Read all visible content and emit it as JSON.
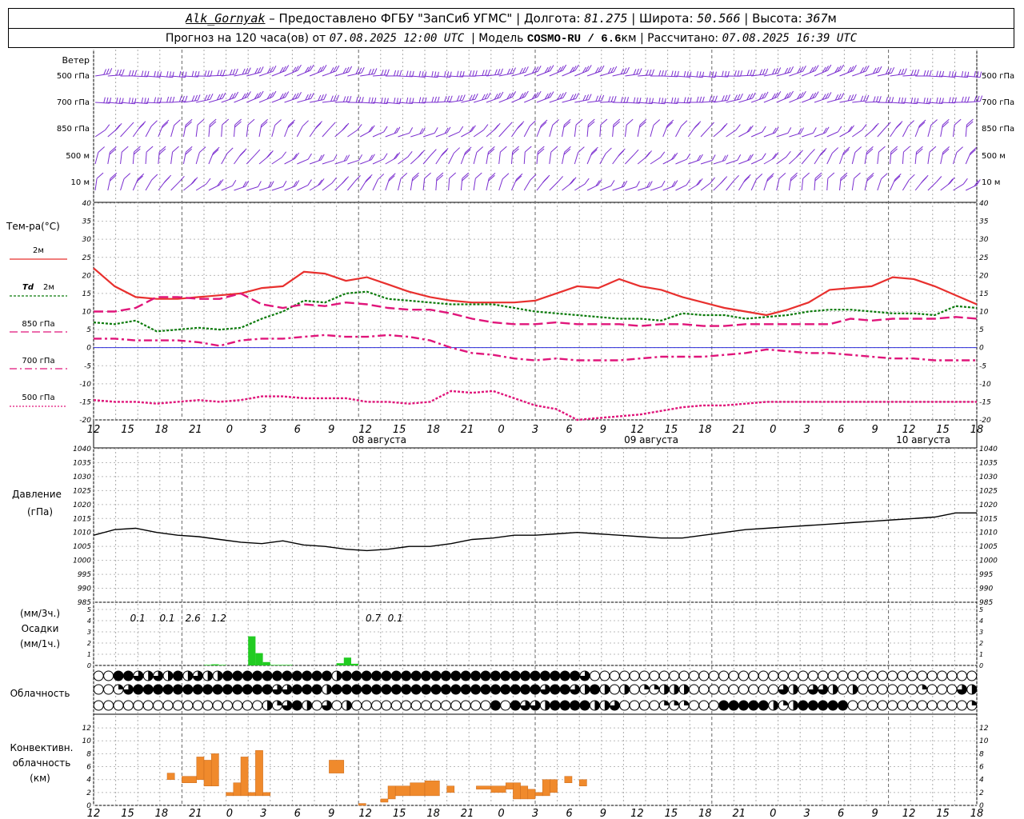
{
  "header": {
    "station": "Alk_Gornyak",
    "provided_by": "– Предоставлено ФГБУ \"ЗапСиб УГМС\"",
    "lon_label": "Долгота:",
    "lon_value": "81.275",
    "lat_label": "Широта:",
    "lat_value": "50.566",
    "alt_label": "Высота:",
    "alt_value": "367",
    "alt_unit": "м",
    "forecast_label": "Прогноз на 120 часа(ов) от",
    "forecast_start": "07.08.2025 12:00 UTC",
    "model_label": "Модель",
    "model_name": "COSMO-RU / 6.6",
    "model_unit": "км",
    "computed_label": "Рассчитано:",
    "computed_value": "07.08.2025 16:39 UTC"
  },
  "labels": {
    "wind_title": "Ветер",
    "temp_title": "Тем-ра(°C)",
    "t2m": "2м",
    "td": "Td",
    "td_2m": "2м",
    "t850": "850 гПа",
    "t700": "700 гПа",
    "t500": "500 гПа",
    "pressure_title": "Давление",
    "pressure_unit": "(гПа)",
    "precip_unit3": "(мм/3ч.)",
    "precip_title": "Осадки",
    "precip_unit1": "(мм/1ч.)",
    "cloud_title": "Облачность",
    "conv_title1": "Конвективн.",
    "conv_title2": "облачность",
    "conv_unit": "(км)"
  },
  "colors": {
    "wind": "#7b2fd0",
    "t2m": "#e8302e",
    "td": "#0a7a0a",
    "t850": "#e0157a",
    "t700": "#e0157a",
    "t500": "#e0157a",
    "pressure": "#000000",
    "precip": "#22cc22",
    "conv": "#f08a2c",
    "zero_line": "#2b2bd8"
  },
  "chart_data": [
    {
      "type": "barbs",
      "name": "wind",
      "levels": [
        "500 гПа",
        "700 гПа",
        "850 гПа",
        "500 м",
        "10 м"
      ],
      "x_hours": [
        0,
        120
      ],
      "barbs_per_level": 70,
      "direction_pattern": "west/north-west barbs, 500 and 700 hPa barbs crowded (strong winds), lower levels weaker"
    },
    {
      "type": "line",
      "name": "temperature",
      "x_tick_labels": [
        "12",
        "15",
        "18",
        "21",
        "0",
        "3",
        "6",
        "9",
        "12",
        "15",
        "18",
        "21",
        "0",
        "3",
        "6",
        "9",
        "12",
        "15",
        "18",
        "21",
        "0",
        "3",
        "6",
        "9",
        "12",
        "15",
        "18"
      ],
      "date_labels": [
        "08 августа",
        "09 августа",
        "10 августа"
      ],
      "ylim": [
        -20,
        40
      ],
      "y_ticks": [
        40,
        35,
        30,
        25,
        20,
        15,
        10,
        5,
        0,
        -5,
        -10,
        -15,
        -20
      ],
      "x_hours": [
        0,
        3,
        6,
        9,
        12,
        15,
        18,
        21,
        24,
        27,
        30,
        33,
        36,
        39,
        42,
        45,
        48,
        51,
        54,
        57,
        60,
        63,
        66,
        69,
        72,
        75,
        78,
        81,
        84,
        87,
        90,
        93,
        96,
        99,
        102,
        105,
        108,
        111,
        114,
        117,
        120
      ],
      "series": [
        {
          "name": "2м",
          "key": "t2m",
          "style": "solid",
          "values": [
            22,
            17,
            14,
            13.5,
            13.5,
            14,
            14.5,
            15,
            16.5,
            17,
            21,
            20.5,
            18.5,
            19.5,
            17.5,
            15.5,
            14,
            13,
            12.5,
            12.5,
            12.5,
            13,
            15,
            17,
            16.5,
            19,
            17,
            16,
            14,
            12.5,
            11,
            10,
            9,
            10.5,
            12.5,
            16,
            16.5,
            17,
            19.5,
            19,
            17,
            14.5,
            12
          ]
        },
        {
          "name": "Td 2м",
          "key": "td",
          "style": "dotted",
          "values": [
            7,
            6.5,
            7.5,
            4.5,
            5,
            5.5,
            5,
            5.5,
            8,
            10,
            13,
            12.5,
            15,
            15.5,
            13.5,
            13,
            12.5,
            12,
            12,
            12,
            11,
            10,
            9.5,
            9,
            8.5,
            8,
            8,
            7.5,
            9.5,
            9,
            9,
            8,
            8.5,
            9,
            10,
            10.5,
            10.5,
            10,
            9.5,
            9.5,
            9,
            11.5,
            11
          ]
        },
        {
          "name": "850 гПа",
          "key": "t850",
          "style": "dashed",
          "values": [
            10,
            10,
            11,
            14,
            14,
            13.5,
            13.5,
            15,
            12,
            11,
            12,
            11.5,
            12.5,
            12,
            11,
            10.5,
            10.5,
            9.5,
            8,
            7,
            6.5,
            6.5,
            7,
            6.5,
            6.5,
            6.5,
            6,
            6.5,
            6.5,
            6,
            6,
            6.5,
            6.5,
            6.5,
            6.5,
            6.5,
            8,
            7.5,
            8,
            8,
            8,
            8.5,
            8
          ]
        },
        {
          "name": "700 гПа",
          "key": "t700",
          "style": "dashdot",
          "values": [
            2.5,
            2.5,
            2,
            2,
            2,
            1.5,
            0.5,
            2,
            2.5,
            2.5,
            3,
            3.5,
            3,
            3,
            3.5,
            3,
            2,
            0,
            -1.5,
            -2,
            -3,
            -3.5,
            -3,
            -3.5,
            -3.5,
            -3.5,
            -3,
            -2.5,
            -2.5,
            -2.5,
            -2,
            -1.5,
            -0.5,
            -1,
            -1.5,
            -1.5,
            -2,
            -2.5,
            -3,
            -3,
            -3.5,
            -3.5,
            -3.5
          ]
        },
        {
          "name": "500 гПа",
          "key": "t500",
          "style": "dotted",
          "values": [
            -14.5,
            -15,
            -15,
            -15.5,
            -15,
            -14.5,
            -15,
            -14.5,
            -13.5,
            -13.5,
            -14,
            -14,
            -14,
            -15,
            -15,
            -15.5,
            -15,
            -12,
            -12.5,
            -12,
            -14,
            -16,
            -17,
            -20,
            -19.5,
            -19,
            -18.5,
            -17.5,
            -16.5,
            -16,
            -16,
            -15.5,
            -15,
            -15,
            -15,
            -15,
            -15,
            -15,
            -15,
            -15,
            -15,
            -15,
            -15
          ]
        }
      ]
    },
    {
      "type": "line",
      "name": "pressure",
      "ylim": [
        985,
        1040
      ],
      "y_ticks": [
        1040,
        1035,
        1030,
        1025,
        1020,
        1015,
        1010,
        1005,
        1000,
        995,
        990,
        985
      ],
      "series": [
        {
          "name": "Давление",
          "values": [
            1009,
            1011,
            1011.5,
            1010,
            1009,
            1008.5,
            1007.5,
            1006.5,
            1006,
            1007,
            1005.5,
            1005,
            1004,
            1003.5,
            1004,
            1005,
            1005,
            1006,
            1007.5,
            1008,
            1009,
            1009,
            1009.5,
            1010,
            1009.5,
            1009,
            1008.5,
            1008,
            1008,
            1009,
            1010,
            1011,
            1011.5,
            1012,
            1012.5,
            1013,
            1013.5,
            1014,
            1014.5,
            1015,
            1015.5,
            1017,
            1017
          ]
        }
      ]
    },
    {
      "type": "bar",
      "name": "precipitation",
      "ylim": [
        0,
        5
      ],
      "y_ticks": [
        0,
        1,
        2,
        3,
        4,
        5
      ],
      "x_hours": [
        15,
        16,
        17,
        21,
        22,
        23,
        24,
        25,
        26,
        33,
        34,
        35
      ],
      "values": [
        0.05,
        0.1,
        0.05,
        2.6,
        1.1,
        0.3,
        0.05,
        0.05,
        0.05,
        0.2,
        0.7,
        0.15
      ],
      "labels_3h": [
        {
          "hour": 6,
          "text": "0.1"
        },
        {
          "hour": 10,
          "text": "0.1"
        },
        {
          "hour": 13.5,
          "text": "2.6"
        },
        {
          "hour": 17,
          "text": "1.2"
        },
        {
          "hour": 38,
          "text": "0.7"
        },
        {
          "hour": 41,
          "text": "0.1"
        }
      ]
    },
    {
      "type": "heatmap",
      "name": "cloudiness",
      "rows": 3,
      "legend": "0 clear, 1 quarter, 2 half, 3 three-quarter, 4 overcast",
      "row_values": [
        [
          0,
          0,
          4,
          4,
          3,
          2,
          3,
          2,
          4,
          2,
          3,
          2,
          2,
          4,
          4,
          4,
          4,
          4,
          4,
          4,
          4,
          4,
          4,
          4,
          2,
          4,
          4,
          4,
          4,
          4,
          4,
          4,
          4,
          4,
          4,
          4,
          4,
          4,
          4,
          4,
          4,
          4,
          4,
          4,
          4,
          4,
          4,
          4,
          4,
          3,
          0,
          0,
          0,
          0,
          0,
          0,
          0,
          0,
          0,
          0,
          0,
          0,
          0,
          0,
          0,
          0,
          0,
          0,
          0,
          0,
          0,
          0,
          0,
          0,
          0,
          0,
          0,
          0,
          0,
          0,
          0,
          0,
          0,
          0,
          0,
          0,
          0,
          0,
          0
        ],
        [
          0,
          0,
          1,
          3,
          4,
          4,
          4,
          4,
          4,
          4,
          4,
          4,
          4,
          4,
          4,
          4,
          4,
          4,
          3,
          3,
          4,
          4,
          4,
          2,
          4,
          4,
          4,
          4,
          4,
          4,
          4,
          4,
          4,
          4,
          4,
          4,
          4,
          4,
          4,
          4,
          4,
          4,
          4,
          4,
          4,
          3,
          4,
          4,
          3,
          2,
          4,
          2,
          0,
          2,
          0,
          1,
          1,
          2,
          2,
          2,
          0,
          0,
          0,
          0,
          0,
          0,
          0,
          0,
          0,
          3,
          2,
          0,
          3,
          3,
          2,
          0,
          2,
          0,
          0,
          0,
          0,
          0,
          0,
          1,
          0,
          0,
          0,
          3,
          2
        ],
        [
          0,
          0,
          0,
          0,
          0,
          0,
          0,
          0,
          0,
          0,
          0,
          0,
          0,
          0,
          0,
          0,
          0,
          2,
          1,
          3,
          4,
          2,
          0,
          3,
          0,
          2,
          0,
          0,
          0,
          0,
          0,
          0,
          0,
          0,
          0,
          0,
          0,
          0,
          0,
          0,
          4,
          0,
          4,
          3,
          3,
          2,
          4,
          4,
          4,
          4,
          2,
          2,
          3,
          0,
          0,
          0,
          0,
          1,
          1,
          1,
          0,
          0,
          0,
          4,
          4,
          4,
          4,
          4,
          2,
          1,
          2,
          4,
          4,
          4,
          4,
          4,
          0,
          0,
          0,
          0,
          0,
          0,
          0,
          0,
          0,
          0,
          0,
          0,
          1
        ]
      ]
    },
    {
      "type": "bar",
      "name": "convective_clouds",
      "ylim": [
        0,
        13
      ],
      "y_ticks": [
        12,
        10,
        8,
        6,
        4,
        2,
        0
      ],
      "segments": [
        {
          "from": -2,
          "to": -1,
          "bottom": 4,
          "top": 5
        },
        {
          "from": 0,
          "to": 2,
          "bottom": 3.5,
          "top": 4.5
        },
        {
          "from": 2,
          "to": 3,
          "bottom": 4,
          "top": 7.5
        },
        {
          "from": 3,
          "to": 4,
          "bottom": 3,
          "top": 7
        },
        {
          "from": 4,
          "to": 5,
          "bottom": 3,
          "top": 8
        },
        {
          "from": 6,
          "to": 7,
          "bottom": 1.5,
          "top": 2
        },
        {
          "from": 7,
          "to": 8,
          "bottom": 1.5,
          "top": 3.5
        },
        {
          "from": 8,
          "to": 9,
          "bottom": 1.5,
          "top": 7.5
        },
        {
          "from": 9,
          "to": 10,
          "bottom": 1.5,
          "top": 2
        },
        {
          "from": 10,
          "to": 11,
          "bottom": 1.5,
          "top": 8.5
        },
        {
          "from": 11,
          "to": 12,
          "bottom": 1.5,
          "top": 2
        },
        {
          "from": 20,
          "to": 22,
          "bottom": 5,
          "top": 7
        },
        {
          "from": 24,
          "to": 25,
          "bottom": 0,
          "top": 0.3
        },
        {
          "from": 27,
          "to": 28,
          "bottom": 0.5,
          "top": 1
        },
        {
          "from": 28,
          "to": 29,
          "bottom": 1,
          "top": 3
        },
        {
          "from": 29,
          "to": 31,
          "bottom": 1.5,
          "top": 3
        },
        {
          "from": 31,
          "to": 33,
          "bottom": 1.5,
          "top": 3.5
        },
        {
          "from": 33,
          "to": 35,
          "bottom": 1.5,
          "top": 3.8
        },
        {
          "from": 36,
          "to": 37,
          "bottom": 2,
          "top": 3
        },
        {
          "from": 40,
          "to": 42,
          "bottom": 2.5,
          "top": 3
        },
        {
          "from": 42,
          "to": 44,
          "bottom": 2,
          "top": 3
        },
        {
          "from": 44,
          "to": 45,
          "bottom": 2.5,
          "top": 3.5
        },
        {
          "from": 45,
          "to": 46,
          "bottom": 1,
          "top": 3.5
        },
        {
          "from": 46,
          "to": 47,
          "bottom": 1,
          "top": 3
        },
        {
          "from": 47,
          "to": 48,
          "bottom": 1,
          "top": 2.5
        },
        {
          "from": 48,
          "to": 49,
          "bottom": 1.5,
          "top": 2
        },
        {
          "from": 49,
          "to": 50,
          "bottom": 1.5,
          "top": 4
        },
        {
          "from": 50,
          "to": 51,
          "bottom": 2,
          "top": 4
        },
        {
          "from": 52,
          "to": 53,
          "bottom": 3.5,
          "top": 4.5
        },
        {
          "from": 54,
          "to": 55,
          "bottom": 3,
          "top": 4
        }
      ]
    }
  ]
}
